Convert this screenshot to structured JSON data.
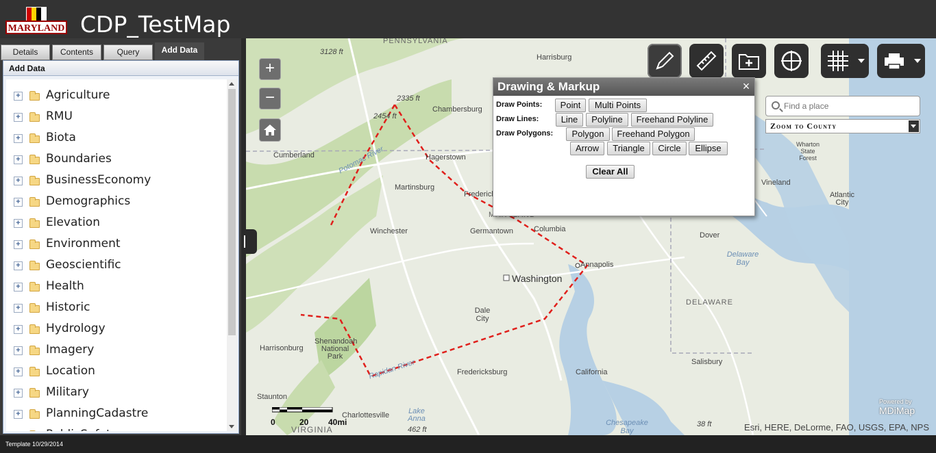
{
  "header": {
    "logo_text": "MARYLAND",
    "title": "CDP_TestMap"
  },
  "tabs": [
    "Details",
    "Contents",
    "Query",
    "Add Data"
  ],
  "active_tab": "Add Data",
  "panel": {
    "heading": "Add Data",
    "items": [
      "Agriculture",
      "RMU",
      "Biota",
      "Boundaries",
      "BusinessEconomy",
      "Demographics",
      "Elevation",
      "Environment",
      "Geoscientific",
      "Health",
      "Historic",
      "Hydrology",
      "Imagery",
      "Location",
      "Military",
      "PlanningCadastre",
      "PublicSafety"
    ]
  },
  "map": {
    "zoom_in": "+",
    "zoom_out": "−",
    "search_placeholder": "Find a place",
    "county_select": "Zoom to County",
    "scale_labels": [
      "0",
      "20",
      "40mi"
    ],
    "attribution": "Esri, HERE, DeLorme, FAO, USGS, EPA, NPS",
    "powered_by": "Powered by",
    "powered_brand": "MDiMap",
    "labels": {
      "pennsylvania": "PENNSYLVANIA",
      "harrisburg": "Harrisburg",
      "chambersburg": "Chambersburg",
      "hagerstown": "Hagerstown",
      "cumberland": "Cumberland",
      "martinsburg": "Martinsburg",
      "frederick": "Frederick",
      "winchester": "Winchester",
      "germantown": "Germantown",
      "columbia": "Columbia",
      "washington": "Washington",
      "annapolis": "Annapolis",
      "dale_city": "Dale City",
      "harrisonburg": "Harrisonburg",
      "shenandoah": "Shenandoah National Park",
      "fredericksburg": "Fredericksburg",
      "california": "California",
      "staunton": "Staunton",
      "charlottesville": "Charlottesville",
      "virginia": "VIRGINIA",
      "lake_anna": "Lake Anna",
      "dover": "Dover",
      "delaware": "DELAWARE",
      "delaware_bay": "Delaware Bay",
      "salisbury": "Salisbury",
      "vineland": "Vineland",
      "atlantic_city": "Atlantic City",
      "wharton": "Wharton State Forest",
      "chesapeake": "Chesapeake Bay",
      "potomac": "Potomac River",
      "rapidan": "Rapidan River",
      "maryland": "MARYLAND",
      "elev_3128": "3128 ft",
      "elev_2335": "2335 ft",
      "elev_2454": "2454 ft",
      "elev_462": "462 ft",
      "elev_38": "38 ft"
    }
  },
  "draw_dialog": {
    "title": "Drawing & Markup",
    "close": "×",
    "points_label": "Draw Points:",
    "lines_label": "Draw Lines:",
    "polygons_label": "Draw Polygons:",
    "point": "Point",
    "multi_points": "Multi Points",
    "line": "Line",
    "polyline": "Polyline",
    "freehand_polyline": "Freehand Polyline",
    "polygon": "Polygon",
    "freehand_polygon": "Freehand Polygon",
    "arrow": "Arrow",
    "triangle": "Triangle",
    "circle": "Circle",
    "ellipse": "Ellipse",
    "clear_all": "Clear All"
  },
  "footer": {
    "text": "Template 10/29/2014"
  },
  "colors": {
    "header_bg": "#333333",
    "draw_line": "#e0201c",
    "map_bg": "#e9ece2"
  }
}
